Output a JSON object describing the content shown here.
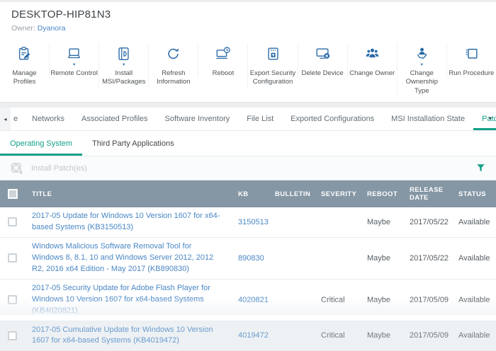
{
  "colors": {
    "accent_green": "#12a089",
    "link_blue": "#4a87c5",
    "toolbar_icon_blue": "#2b6ba8",
    "table_header_bg": "#8596a4"
  },
  "header": {
    "device_name": "DESKTOP-HIP81N3",
    "owner_label": "Owner:",
    "owner_name": "Dyanora"
  },
  "toolbar": {
    "buttons": [
      {
        "label": "Manage Profiles",
        "icon": "manage-profiles-icon",
        "caret": ""
      },
      {
        "label": "Remote Control",
        "icon": "remote-control-icon",
        "caret": "▾"
      },
      {
        "label": "Install MSI/Packages",
        "icon": "install-msi-icon",
        "caret": "▾"
      },
      {
        "label": "Refresh Information",
        "icon": "refresh-icon",
        "caret": ""
      },
      {
        "label": "Reboot",
        "icon": "reboot-icon",
        "caret": ""
      },
      {
        "label": "Export Security Configuration",
        "icon": "export-security-icon",
        "caret": ""
      },
      {
        "label": "Delete Device",
        "icon": "delete-device-icon",
        "caret": ""
      },
      {
        "label": "Change Owner",
        "icon": "change-owner-icon",
        "caret": ""
      },
      {
        "label": "Change Ownership Type",
        "icon": "change-ownership-icon",
        "caret": "▾"
      },
      {
        "label": "Run Procedure",
        "icon": "run-procedure-icon",
        "caret": ""
      }
    ]
  },
  "tabbar": {
    "left_arrow": "◂",
    "right_arrow": "▸",
    "partial_tab": "e",
    "tabs": [
      {
        "label": "Networks"
      },
      {
        "label": "Associated Profiles"
      },
      {
        "label": "Software Inventory"
      },
      {
        "label": "File List"
      },
      {
        "label": "Exported Configurations"
      },
      {
        "label": "MSI Installation State"
      },
      {
        "label": "Patch Managem"
      }
    ]
  },
  "subtabs": [
    {
      "label": "Operating System"
    },
    {
      "label": "Third Party Applications"
    }
  ],
  "actionbar": {
    "install_patches_label": "Install Patch(es)"
  },
  "table": {
    "columns": [
      "TITLE",
      "KB",
      "BULLETIN",
      "SEVERITY",
      "REBOOT",
      "RELEASE DATE",
      "STATUS"
    ],
    "rows": [
      {
        "title": "2017-05 Update for Windows 10 Version 1607 for x64-based Systems (KB3150513)",
        "kb": "3150513",
        "bulletin": "",
        "severity": "",
        "reboot": "Maybe",
        "release_date": "2017/05/22",
        "status": "Available"
      },
      {
        "title": "Windows Malicious Software Removal Tool for Windows 8, 8.1, 10 and Windows Server 2012, 2012 R2, 2016 x64 Edition - May 2017 (KB890830)",
        "kb": "890830",
        "bulletin": "",
        "severity": "",
        "reboot": "Maybe",
        "release_date": "2017/05/22",
        "status": "Available"
      },
      {
        "title": "2017-05 Security Update for Adobe Flash Player for Windows 10 Version 1607 for x64-based Systems (KB4020821)",
        "kb": "4020821",
        "bulletin": "",
        "severity": "Critical",
        "reboot": "Maybe",
        "release_date": "2017/05/09",
        "status": "Available"
      },
      {
        "title": "2017-05 Cumulative Update for Windows 10 Version 1607 for x64-based Systems (KB4019472)",
        "kb": "4019472",
        "bulletin": "",
        "severity": "Critical",
        "reboot": "Maybe",
        "release_date": "2017/05/09",
        "status": "Available"
      }
    ]
  }
}
